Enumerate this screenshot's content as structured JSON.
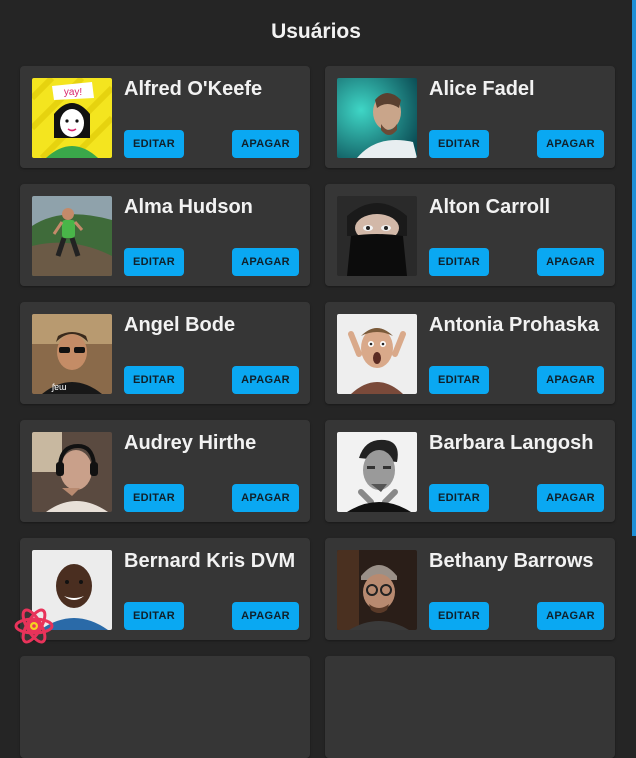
{
  "page": {
    "title": "Usuários"
  },
  "labels": {
    "edit": "EDITAR",
    "delete": "APAGAR"
  },
  "users": [
    {
      "name": "Alfred O'Keefe",
      "avatar": "cartoon-girl-yay",
      "banner": "yay!"
    },
    {
      "name": "Alice Fadel",
      "avatar": "man-teal-background"
    },
    {
      "name": "Alma Hudson",
      "avatar": "trail-runner"
    },
    {
      "name": "Alton Carroll",
      "avatar": "masked-face"
    },
    {
      "name": "Angel Bode",
      "avatar": "man-sunglasses"
    },
    {
      "name": "Antonia Prohaska",
      "avatar": "screaming-man"
    },
    {
      "name": "Audrey Hirthe",
      "avatar": "man-headphones"
    },
    {
      "name": "Barbara Langosh",
      "avatar": "man-bw-portrait"
    },
    {
      "name": "Bernard Kris DVM",
      "avatar": "smiling-man"
    },
    {
      "name": "Bethany Barrows",
      "avatar": "man-beanie-glasses"
    }
  ],
  "colors": {
    "accent": "#0aa8f2",
    "card": "#363636",
    "background": "#252525"
  }
}
